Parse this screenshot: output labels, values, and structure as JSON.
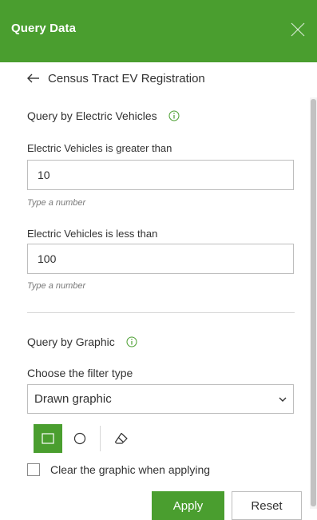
{
  "header": {
    "title": "Query Data",
    "close_icon": "close-icon"
  },
  "nav": {
    "back_label": "Census Tract EV Registration",
    "back_icon": "arrow-left-icon"
  },
  "attribute_query": {
    "title": "Query by Electric Vehicles",
    "info_icon": "info-icon",
    "greater_than": {
      "label": "Electric Vehicles is greater than",
      "value": "10",
      "hint": "Type a number"
    },
    "less_than": {
      "label": "Electric Vehicles is less than",
      "value": "100",
      "hint": "Type a number"
    }
  },
  "spatial_query": {
    "title": "Query by Graphic",
    "info_icon": "info-icon",
    "filter_type_label": "Choose the filter type",
    "filter_type_value": "Drawn graphic",
    "tools": [
      "rectangle-icon",
      "circle-icon",
      "eraser-icon"
    ],
    "active_tool": "rectangle-icon",
    "clear_graphic_label": "Clear the graphic when applying",
    "clear_graphic_checked": false
  },
  "actions": {
    "apply_label": "Apply",
    "reset_label": "Reset"
  },
  "colors": {
    "accent": "#4a9e2f",
    "text": "#323232",
    "hint": "#7a7a7a",
    "border": "#bdbdbd"
  }
}
